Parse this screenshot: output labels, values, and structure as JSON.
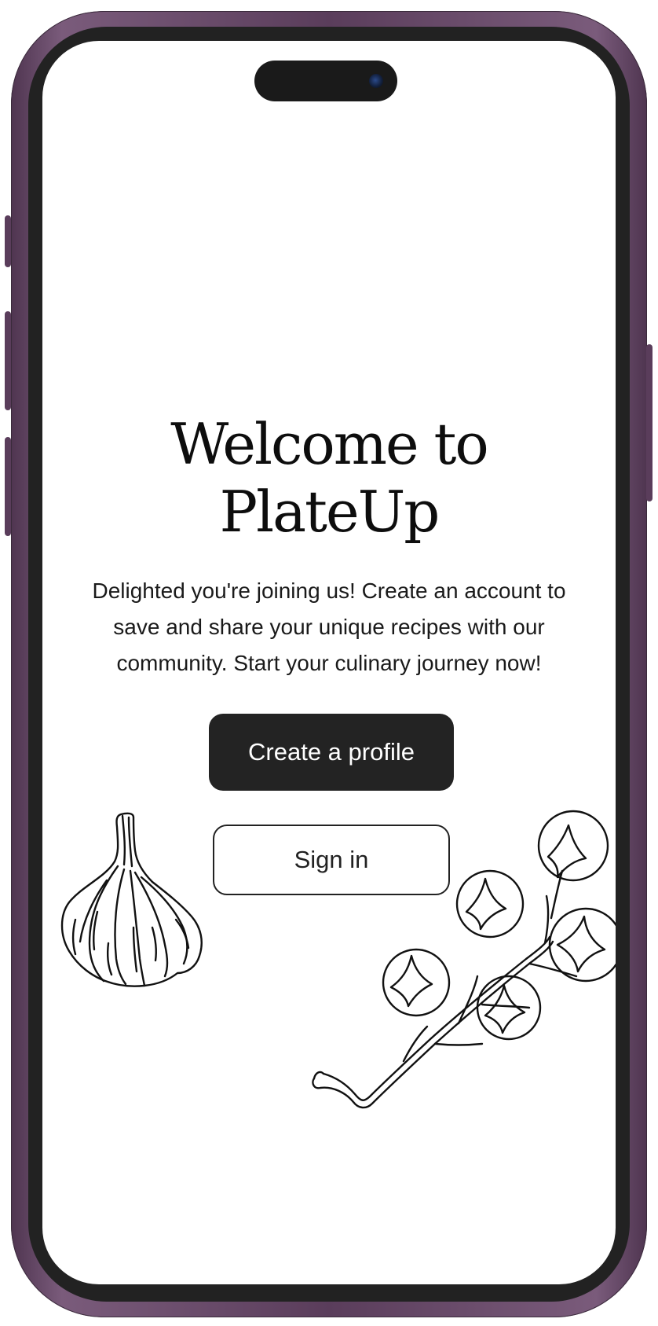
{
  "welcome": {
    "title_line1": "Welcome to",
    "title_line2": "PlateUp",
    "subtitle": "Delighted you're joining us! Create an account to save and share your unique recipes with our community. Start your culinary journey now!"
  },
  "actions": {
    "create_profile_label": "Create a profile",
    "sign_in_label": "Sign in"
  },
  "illustrations": {
    "left": "garlic-illustration",
    "right": "cherry-tomatoes-illustration"
  },
  "colors": {
    "frame": "#5a3d5b",
    "bezel": "#222222",
    "primary_button": "#232323",
    "text": "#0d0d0d"
  }
}
